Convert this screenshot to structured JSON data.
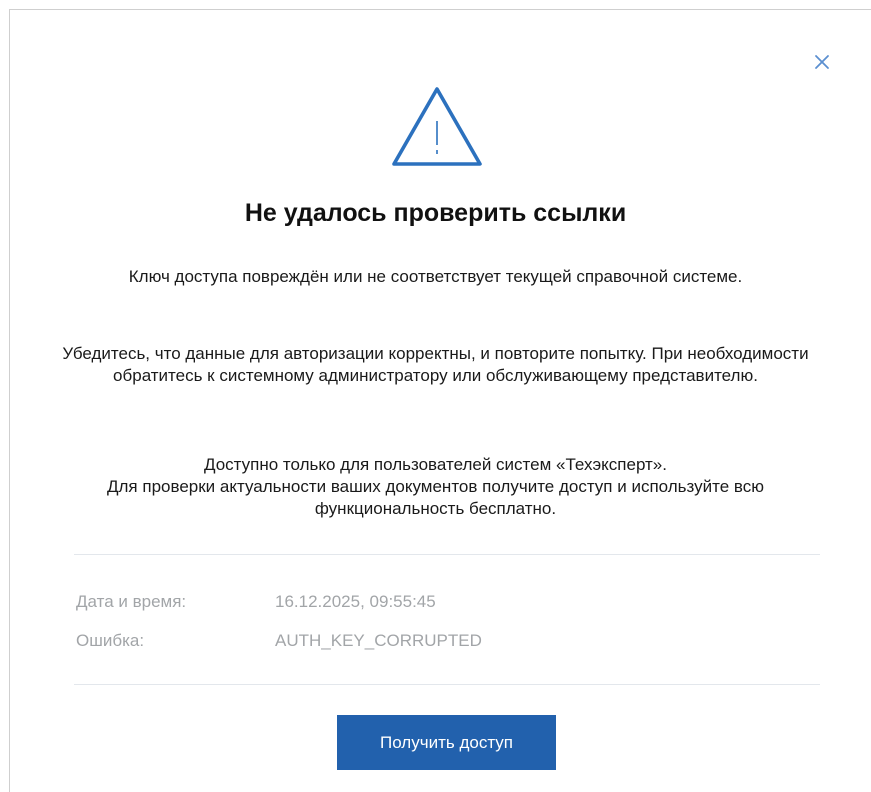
{
  "dialog": {
    "title": "Не удалось проверить ссылки",
    "message_1": "Ключ доступа повреждён или не соответствует текущей справочной системе.",
    "message_2": "Убедитесь, что данные для авторизации корректны, и повторите попытку. При необходимости обратитесь к системному администратору или обслуживающему представителю.",
    "message_3_line1": "Доступно только для пользователей систем «Техэксперт».",
    "message_3_line2": "Для проверки актуальности ваших документов получите доступ и используйте всю функциональность бесплатно.",
    "info": {
      "date_label": "Дата и время:",
      "date_value": "16.12.2025, 09:55:45",
      "error_label": "Ошибка:",
      "error_value": "AUTH_KEY_CORRUPTED"
    },
    "button_label": "Получить доступ",
    "icons": {
      "close": "close-icon",
      "warning": "warning-triangle-icon"
    },
    "colors": {
      "accent": "#2261ad",
      "icon": "#2c71be",
      "close_icon": "#5b8fd0",
      "muted_text": "#a2a5a8",
      "divider": "#e3e7ec"
    }
  }
}
